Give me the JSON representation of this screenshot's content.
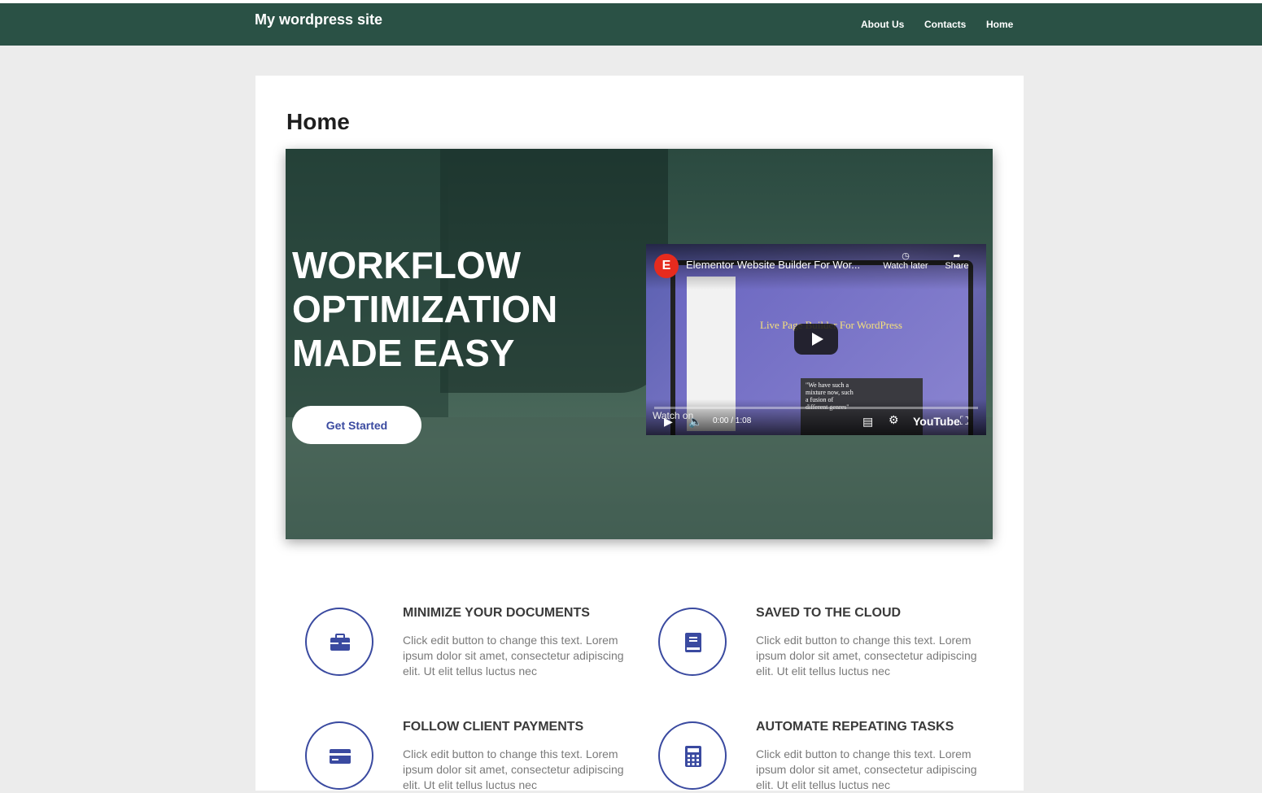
{
  "header": {
    "site_title": "My wordpress site",
    "nav": [
      "About Us",
      "Contacts",
      "Home"
    ]
  },
  "page": {
    "title": "Home"
  },
  "hero": {
    "heading_lines": [
      "WORKFLOW",
      "OPTIMIZATION",
      "MADE EASY"
    ],
    "cta_label": "Get Started",
    "video": {
      "channel_logo": "E",
      "title": "Elementor Website Builder For Wor...",
      "watch_later": "Watch later",
      "share": "Share",
      "overlay_text": "Live Page Builder For WordPress",
      "quote": "\"We have such a mixture now, such a fusion of different genres\"",
      "watch_on": "Watch on",
      "youtube_label": "YouTube",
      "time": "0:00 / 1:08"
    }
  },
  "features": [
    {
      "icon": "briefcase-icon",
      "title": "MINIMIZE YOUR DOCUMENTS",
      "text": "Click edit button to change this text. Lorem ipsum dolor sit amet, consectetur adipiscing elit. Ut elit tellus luctus nec"
    },
    {
      "icon": "book-icon",
      "title": "SAVED TO THE CLOUD",
      "text": "Click edit button to change this text. Lorem ipsum dolor sit amet, consectetur adipiscing elit. Ut elit tellus luctus nec"
    },
    {
      "icon": "credit-card-icon",
      "title": "FOLLOW CLIENT PAYMENTS",
      "text": "Click edit button to change this text. Lorem ipsum dolor sit amet, consectetur adipiscing elit. Ut elit tellus luctus nec"
    },
    {
      "icon": "calculator-icon",
      "title": "AUTOMATE REPEATING TASKS",
      "text": "Click edit button to change this text. Lorem ipsum dolor sit amet, consectetur adipiscing elit. Ut elit tellus luctus nec"
    }
  ],
  "colors": {
    "header_bg": "#2a5145",
    "accent": "#3a4aa0",
    "page_bg": "#ececec"
  }
}
